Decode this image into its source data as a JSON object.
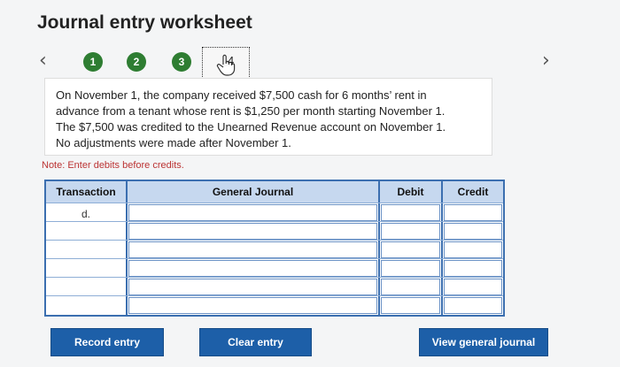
{
  "page": {
    "title": "Journal entry worksheet"
  },
  "nav": {
    "prev_icon": "chevron-left-icon",
    "next_icon": "chevron-right-icon",
    "steps": [
      {
        "label": "1"
      },
      {
        "label": "2"
      },
      {
        "label": "3"
      },
      {
        "label": "4",
        "icon": "hand-pointer-icon"
      }
    ]
  },
  "problem": {
    "lines": [
      "On November 1, the company received $7,500 cash for 6 months’ rent in",
      "advance from a tenant whose rent is $1,250 per month starting November 1.",
      "The $7,500 was credited to the Unearned Revenue account on November 1.",
      "No adjustments were made after November 1."
    ]
  },
  "note": "Note: Enter debits before credits.",
  "table": {
    "headers": {
      "transaction": "Transaction",
      "journal": "General Journal",
      "debit": "Debit",
      "credit": "Credit"
    },
    "transaction_label": "d."
  },
  "buttons": {
    "record": "Record entry",
    "clear": "Clear entry",
    "view": "View general journal"
  },
  "colors": {
    "step_green": "#2e7d32",
    "button_blue": "#1d5fa8",
    "header_blue": "#c6d8ef"
  }
}
